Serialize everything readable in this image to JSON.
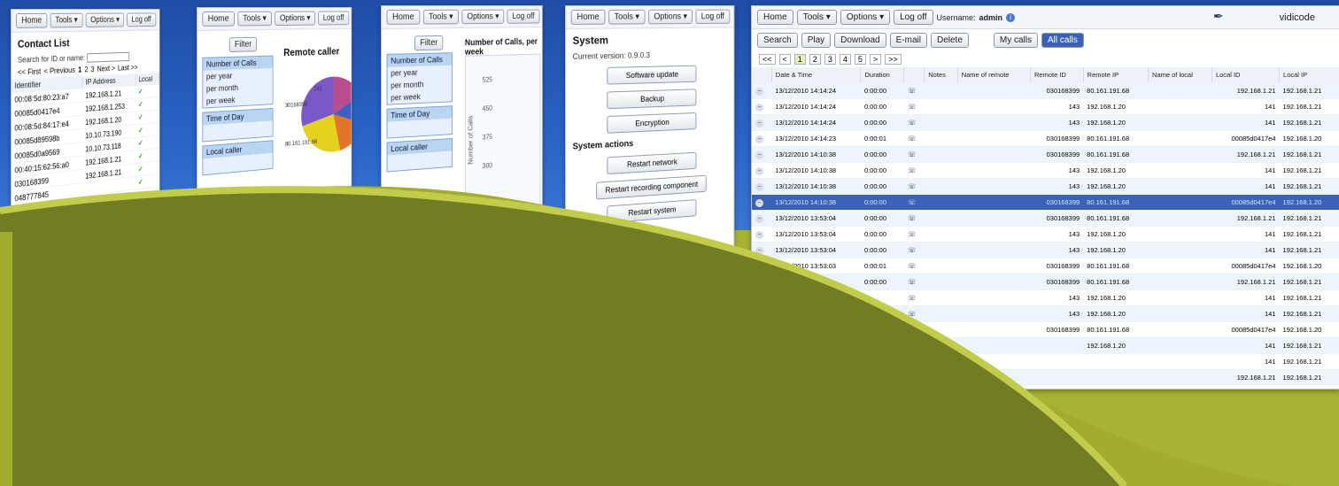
{
  "toolbar": {
    "home": "Home",
    "tools": "Tools ▾",
    "options": "Options ▾",
    "logoff": "Log off",
    "username_label": "Username:",
    "username_value": "admin"
  },
  "contacts": {
    "title": "Contact List",
    "search_label": "Search for ID or name:",
    "pager": [
      "<< First",
      "< Previous",
      "1",
      "2",
      "3",
      "Next >",
      "Last >>"
    ],
    "columns": [
      "Identifier",
      "IP Address",
      "Local"
    ],
    "rows": [
      [
        "00:08:5d:80:23:a7",
        "192.168.1.21"
      ],
      [
        "00085d0417e4",
        "192.168.1.253"
      ],
      [
        "00:08:5d:84:17:e4",
        "192.168.1.20"
      ],
      [
        "00085d89598b",
        "10.10.73.190"
      ],
      [
        "00085d0a9569",
        "10.10.73.118"
      ],
      [
        "00:40:15:62:56:a0",
        "192.168.1.21"
      ],
      [
        "030168399",
        "192.168.1.21"
      ],
      [
        "048777845",
        ""
      ]
    ]
  },
  "stats": {
    "filter": "Filter",
    "number_of_calls": "Number of Calls",
    "per_year": "per year",
    "per_month": "per month",
    "per_week": "per week",
    "time_of_day": "Time of Day",
    "local_caller": "Local caller",
    "remote_caller": "Remote caller",
    "chart_title": "Number of Calls, per week",
    "pie_labels": [
      "141",
      "142",
      "30168399",
      "80.161.191.68",
      "030168399"
    ],
    "y_ticks": [
      "525",
      "450",
      "375",
      "300"
    ],
    "y_axis_label": "Number of Calls"
  },
  "system": {
    "title": "System",
    "version": "Current version: 0.9.0.3",
    "buttons": [
      "Software update",
      "Backup",
      "Encryption"
    ],
    "actions_title": "System actions",
    "actions": [
      "Restart network",
      "Restart recording component",
      "Restart system"
    ]
  },
  "calls": {
    "actions": [
      "Search",
      "Play",
      "Download",
      "E-mail",
      "Delete"
    ],
    "filters": [
      "My calls",
      "All calls"
    ],
    "pages": [
      "<<",
      "<",
      "1",
      "2",
      "3",
      "4",
      "5",
      ">",
      ">>"
    ],
    "brand": "vidicode",
    "columns": [
      "Date & Time",
      "Duration",
      "",
      "Notes",
      "Name of remote",
      "Remote ID",
      "Remote IP",
      "Name of local",
      "Local ID",
      "Local IP"
    ],
    "rows": [
      [
        "13/12/2010 14:14:24",
        "0:00:00",
        "030168399",
        "80.161.191.68",
        "192.168.1.21",
        "192.168.1.21"
      ],
      [
        "13/12/2010 14:14:24",
        "0:00:00",
        "143",
        "192.168.1.20",
        "141",
        "192.168.1.21"
      ],
      [
        "13/12/2010 14:14:24",
        "0:00:00",
        "143",
        "192.168.1.20",
        "141",
        "192.168.1.21"
      ],
      [
        "13/12/2010 14:14:23",
        "0:00:01",
        "030168399",
        "80.161.191.68",
        "00085d0417e4",
        "192.168.1.20"
      ],
      [
        "13/12/2010 14:10:38",
        "0:00:00",
        "030168399",
        "80.161.191.68",
        "192.168.1.21",
        "192.168.1.21"
      ],
      [
        "13/12/2010 14:10:38",
        "0:00:00",
        "143",
        "192.168.1.20",
        "141",
        "192.168.1.21"
      ],
      [
        "13/12/2010 14:10:38",
        "0:00:00",
        "143",
        "192.168.1.20",
        "141",
        "192.168.1.21"
      ],
      [
        "13/12/2010 14:10:38",
        "0:00:00",
        "030168399",
        "80.161.191.68",
        "00085d0417e4",
        "192.168.1.20"
      ],
      [
        "13/12/2010 13:53:04",
        "0:00:00",
        "030168399",
        "80.161.191.68",
        "192.168.1.21",
        "192.168.1.21"
      ],
      [
        "13/12/2010 13:53:04",
        "0:00:00",
        "143",
        "192.168.1.20",
        "141",
        "192.168.1.21"
      ],
      [
        "13/12/2010 13:53:04",
        "0:00:00",
        "143",
        "192.168.1.20",
        "141",
        "192.168.1.21"
      ],
      [
        "13/12/2010 13:53:03",
        "0:00:01",
        "030168399",
        "80.161.191.68",
        "00085d0417e4",
        "192.168.1.20"
      ],
      [
        "",
        "0:00:00",
        "030168399",
        "80.161.191.68",
        "192.168.1.21",
        "192.168.1.21"
      ],
      [
        "",
        "",
        "143",
        "192.168.1.20",
        "141",
        "192.168.1.21"
      ],
      [
        "",
        "",
        "143",
        "192.168.1.20",
        "141",
        "192.168.1.21"
      ],
      [
        "",
        "",
        "030168399",
        "80.161.191.68",
        "00085d0417e4",
        "192.168.1.20"
      ],
      [
        "",
        "",
        "",
        "192.168.1.20",
        "141",
        "192.168.1.21"
      ],
      [
        "",
        "",
        "",
        "",
        "141",
        "192.168.1.21"
      ],
      [
        "",
        "",
        "",
        "",
        "192.168.1.21",
        "192.168.1.21"
      ],
      [
        "",
        "",
        "",
        "",
        "00085d0417e4",
        "192.168.1.20"
      ]
    ],
    "selected_index": 7
  }
}
